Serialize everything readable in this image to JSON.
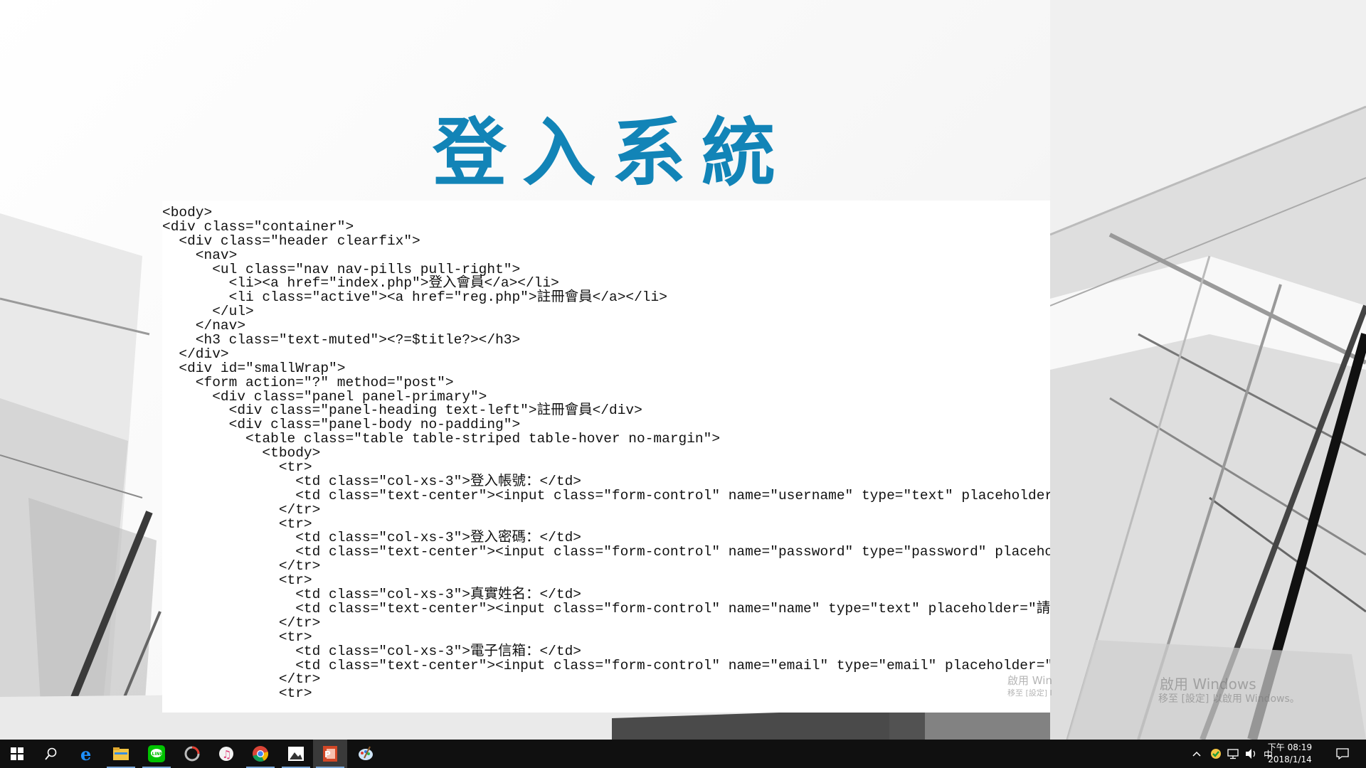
{
  "slide": {
    "title": "登入系統",
    "code_lines": [
      "<body>",
      "<div class=\"container\">",
      "  <div class=\"header clearfix\">",
      "    <nav>",
      "      <ul class=\"nav nav-pills pull-right\">",
      "        <li><a href=\"index.php\">登入會員</a></li>",
      "        <li class=\"active\"><a href=\"reg.php\">註冊會員</a></li>",
      "      </ul>",
      "    </nav>",
      "    <h3 class=\"text-muted\"><?=$title?></h3>",
      "  </div>",
      "  <div id=\"smallWrap\">",
      "    <form action=\"?\" method=\"post\">",
      "      <div class=\"panel panel-primary\">",
      "        <div class=\"panel-heading text-left\">註冊會員</div>",
      "        <div class=\"panel-body no-padding\">",
      "          <table class=\"table table-striped table-hover no-margin\">",
      "            <tbody>",
      "              <tr>",
      "                <td class=\"col-xs-3\">登入帳號：</td>",
      "                <td class=\"text-center\"><input class=\"form-control\" name=\"username\" type=\"text\" placeholder=\"請輸入你的登",
      "              </tr>",
      "              <tr>",
      "                <td class=\"col-xs-3\">登入密碼：</td>",
      "                <td class=\"text-center\"><input class=\"form-control\" name=\"password\" type=\"password\" placeholder=\"請輸入你",
      "              </tr>",
      "              <tr>",
      "                <td class=\"col-xs-3\">真實姓名：</td>",
      "                <td class=\"text-center\"><input class=\"form-control\" name=\"name\" type=\"text\" placeholder=\"請輸入你的真實姓",
      "              </tr>",
      "              <tr>",
      "                <td class=\"col-xs-3\">電子信箱：</td>",
      "                <td class=\"text-center\"><input class=\"form-control\" name=\"email\" type=\"email\" placeholder=\"請輸入你的電子",
      "              </tr>",
      "              <tr>"
    ]
  },
  "watermark": {
    "line1": "啟用 Windows",
    "line2": "移至 [設定] 以啟用 Windows。",
    "line1_partial": "啟用 Win",
    "line2_partial": "移至 [設定] l"
  },
  "taskbar": {
    "apps": [
      {
        "name": "start-icon"
      },
      {
        "name": "search-icon"
      },
      {
        "name": "edge-icon"
      },
      {
        "name": "file-explorer-icon"
      },
      {
        "name": "line-icon"
      },
      {
        "name": "app-icon"
      },
      {
        "name": "itunes-icon"
      },
      {
        "name": "chrome-icon"
      },
      {
        "name": "photos-icon"
      },
      {
        "name": "powerpoint-icon"
      },
      {
        "name": "paint-icon"
      }
    ],
    "tray": {
      "ime": "中",
      "time": "下午 08:19",
      "date": "2018/1/14"
    },
    "colors": {
      "background": "#101010",
      "accent": "#7aa7d8"
    }
  },
  "colors": {
    "title": "#1284b7"
  }
}
